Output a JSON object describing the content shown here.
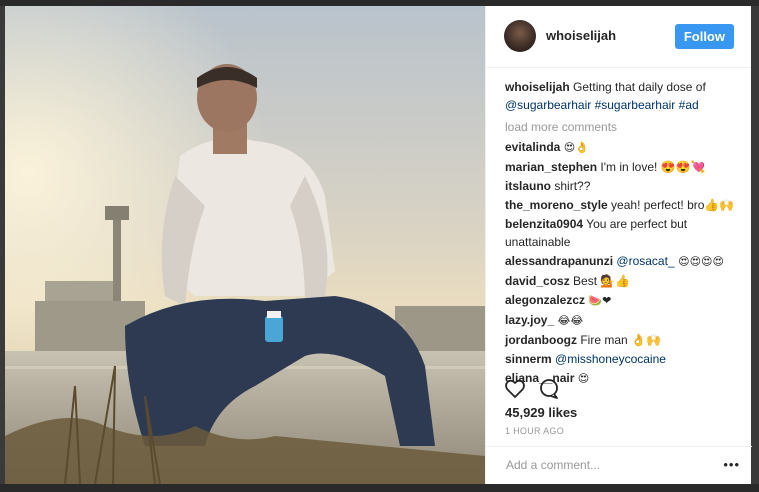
{
  "post": {
    "username": "whoiselijah",
    "follow_label": "Follow",
    "caption": {
      "user": "whoiselijah",
      "text": "Getting that daily dose of",
      "tags": [
        "@sugarbearhair",
        "#sugarbearhair",
        "#ad"
      ]
    },
    "load_more": "load more comments",
    "comments": [
      {
        "user": "evitalinda",
        "text": "😍👌"
      },
      {
        "user": "marian_stephen",
        "text": "I'm in love! 😍😍💘"
      },
      {
        "user": "itslauno",
        "text": "shirt??"
      },
      {
        "user": "the_moreno_style",
        "text": "yeah! perfect! bro👍🙌"
      },
      {
        "user": "belenzita0904",
        "text": "You are perfect but unattainable"
      },
      {
        "user": "alessandrapanunzi",
        "text": "",
        "mention": "@rosacat_",
        "after": " 😍😍😍😍"
      },
      {
        "user": "david_cosz",
        "text": "Best 💁👍"
      },
      {
        "user": "alegonzalezcz",
        "text": "🍉❤"
      },
      {
        "user": "lazy.joy_",
        "text": "😂😂"
      },
      {
        "user": "jordanboogz",
        "text": "Fire man 👌🙌"
      },
      {
        "user": "sinnerm",
        "text": "",
        "mention": "@misshoneycocaine",
        "after": ""
      },
      {
        "user": "eliana__nair",
        "text": "😍"
      }
    ],
    "likes": "45,929 likes",
    "time_ago": "1 HOUR AGO",
    "add_comment_placeholder": "Add a comment...",
    "more_label": "•••",
    "icons": {
      "like": "heart-outline-icon",
      "comment": "speech-bubble-icon"
    },
    "colors": {
      "follow_button": "#3897f0",
      "link": "#003569"
    }
  }
}
